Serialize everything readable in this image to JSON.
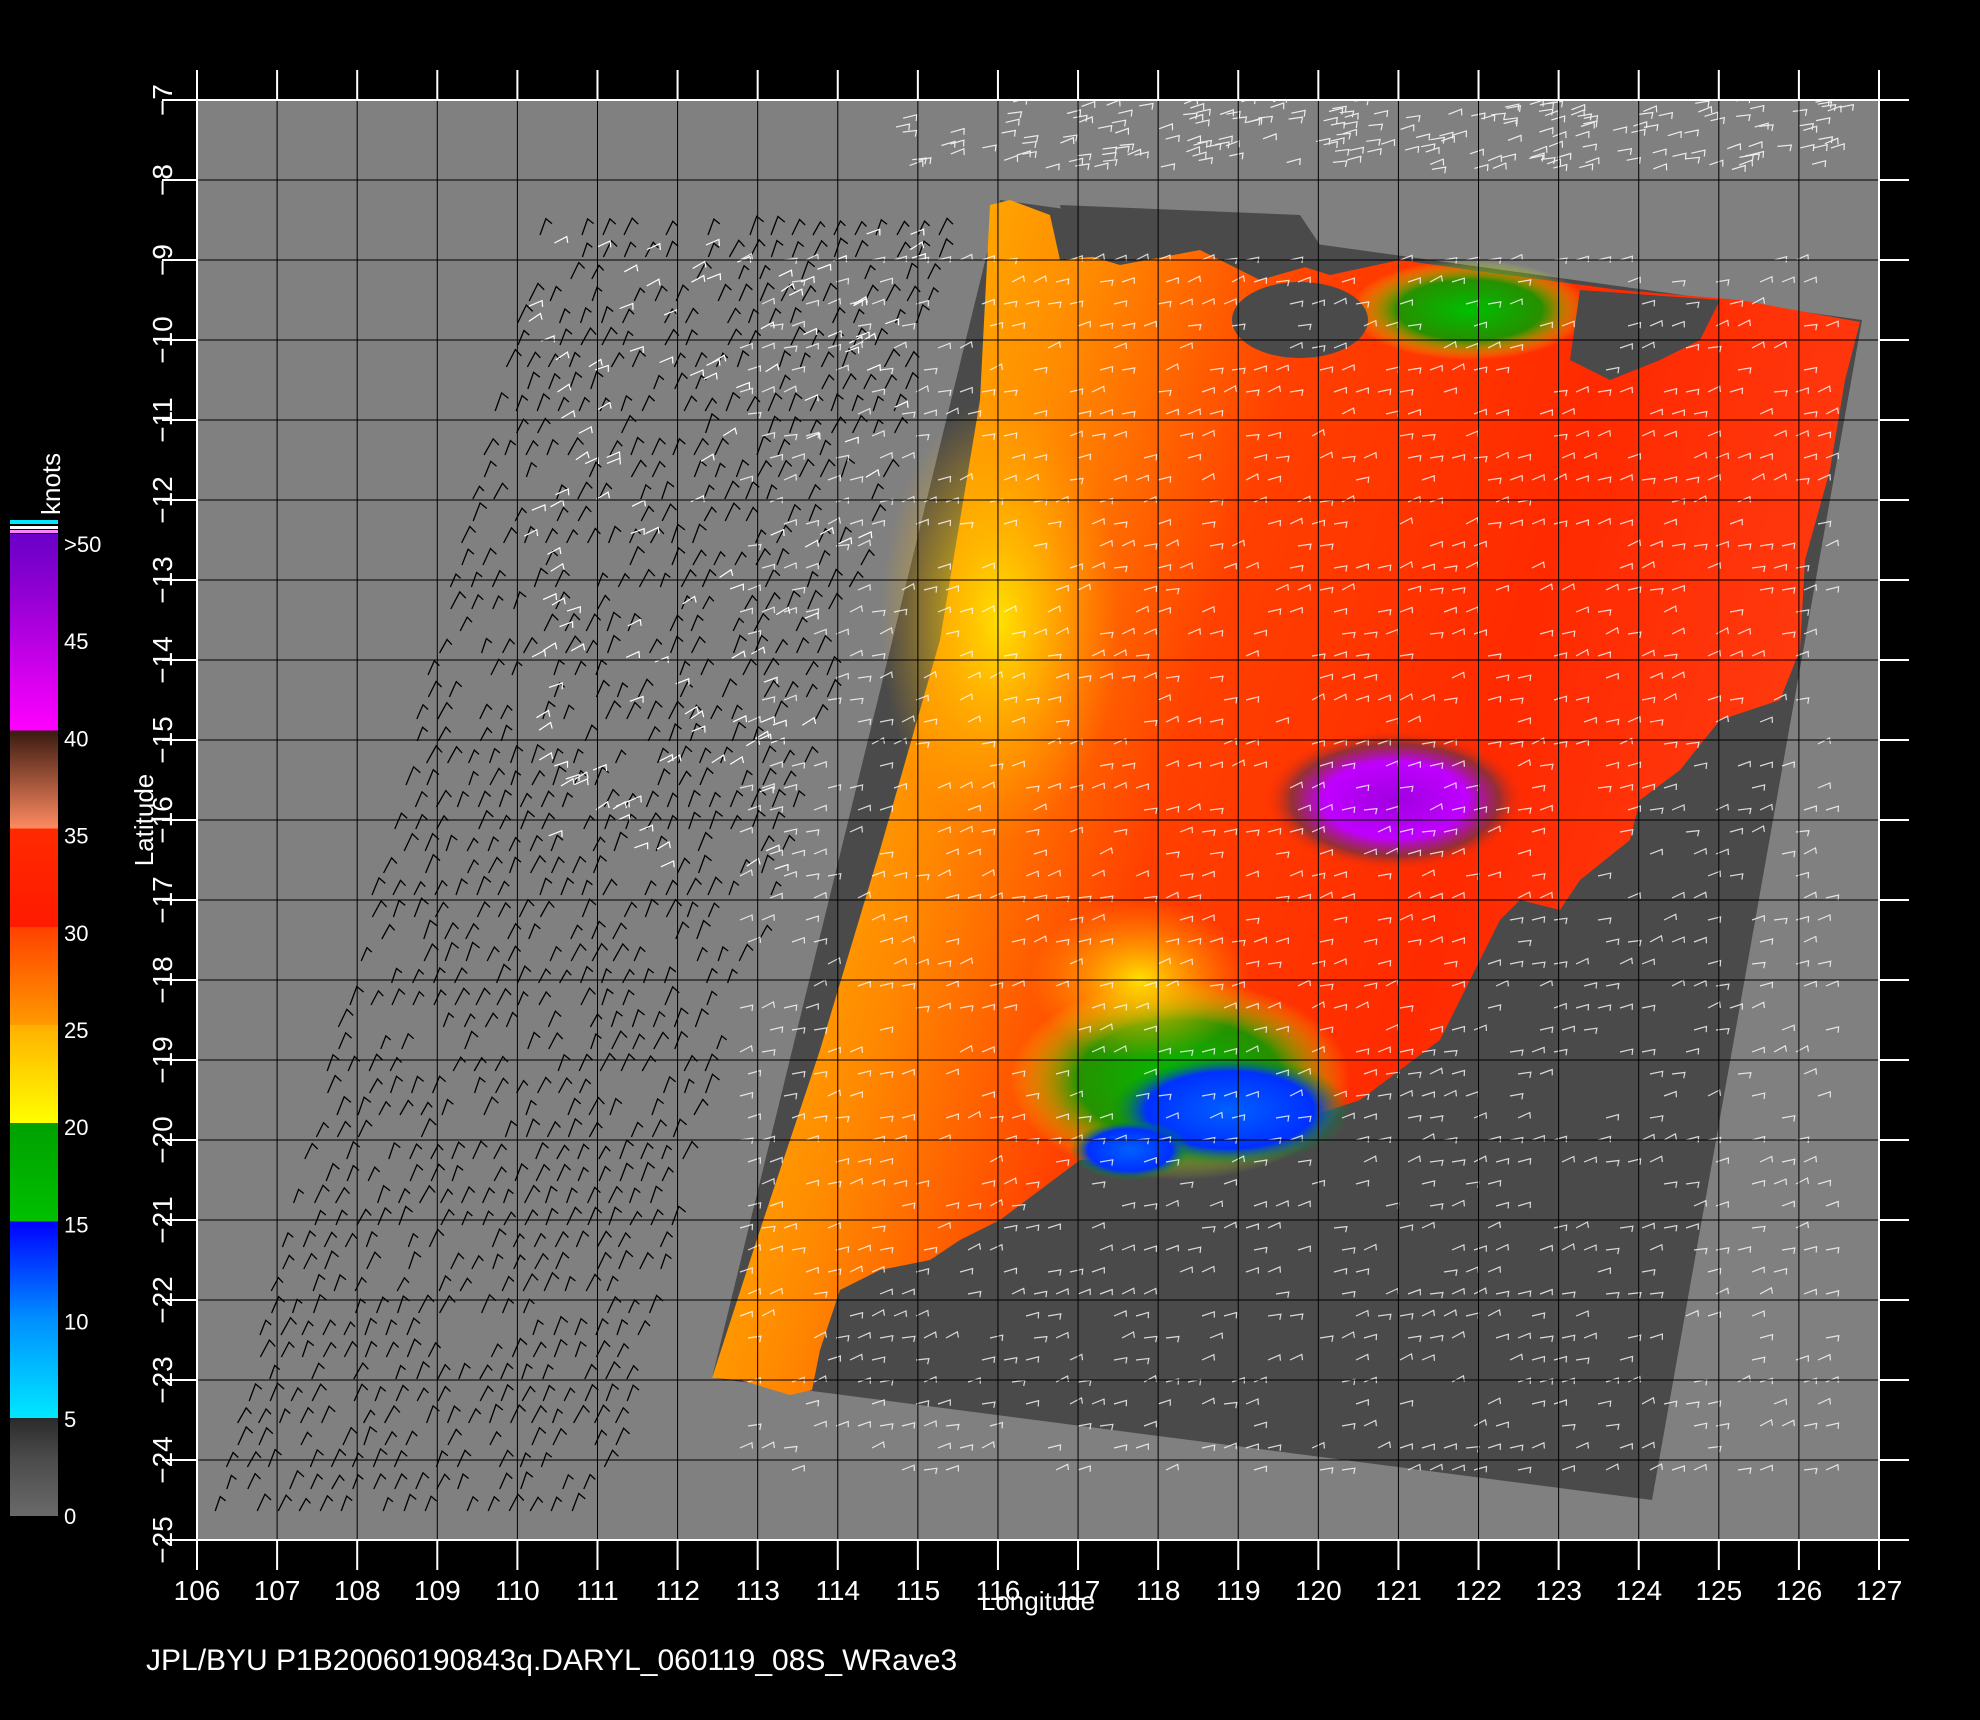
{
  "map": {
    "xlabel": "Longitude",
    "ylabel": "Latitude",
    "lon_ticks": [
      "106",
      "107",
      "108",
      "109",
      "110",
      "111",
      "112",
      "113",
      "114",
      "115",
      "116",
      "117",
      "118",
      "119",
      "120",
      "121",
      "122",
      "123",
      "124",
      "125",
      "126",
      "127"
    ],
    "lat_ticks": [
      "−7",
      "−8",
      "−9",
      "−10",
      "−11",
      "−12",
      "−13",
      "−14",
      "−15",
      "−16",
      "−17",
      "−18",
      "−19",
      "−20",
      "−21",
      "−22",
      "−23",
      "−24",
      "−25"
    ],
    "lon_range": [
      106,
      127
    ],
    "lat_range": [
      -25,
      -7
    ],
    "background_color": "#808080",
    "grid_color": "#000000",
    "swath_dark_color": "#4a4a4a"
  },
  "colorbar": {
    "unit": "knots",
    "labels": [
      ">50",
      "45",
      "40",
      "35",
      "30",
      "25",
      "20",
      "15",
      "10",
      "5",
      "0"
    ],
    "stops": [
      {
        "value": 0,
        "color": "#6a6a6a"
      },
      {
        "value": 5,
        "color": "#00e8ff"
      },
      {
        "value": 10,
        "color": "#0090ff"
      },
      {
        "value": 15,
        "color": "#0000ff"
      },
      {
        "value": 17,
        "color": "#00a000"
      },
      {
        "value": 20,
        "color": "#ffff00"
      },
      {
        "value": 25,
        "color": "#ff9a00"
      },
      {
        "value": 30,
        "color": "#ff2a00"
      },
      {
        "value": 35,
        "color": "#ff5a30"
      },
      {
        "value": 38,
        "color": "#8a4a30"
      },
      {
        "value": 40,
        "color": "#ff00ff"
      },
      {
        "value": 50,
        "color": "#6a00c8"
      }
    ]
  },
  "footer": {
    "text": "JPL/BYU  P1B20060190843q.DARYL_060119_08S_WRave3"
  }
}
